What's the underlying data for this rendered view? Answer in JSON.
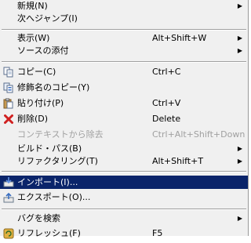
{
  "menu": {
    "items": [
      {
        "label": "新規(N)",
        "shortcut": "",
        "submenu": true
      },
      {
        "label": "次へジャンプ(I)",
        "shortcut": "",
        "submenu": false
      },
      {
        "label": "表示(W)",
        "shortcut": "Alt+Shift+W",
        "submenu": true
      },
      {
        "label": "ソースの添付",
        "shortcut": "",
        "submenu": true
      },
      {
        "label": "コピー(C)",
        "shortcut": "Ctrl+C",
        "icon": "copy-icon"
      },
      {
        "label": "修飾名のコピー(Y)",
        "shortcut": "",
        "icon": "qualified-copy-icon"
      },
      {
        "label": "貼り付け(P)",
        "shortcut": "Ctrl+V",
        "icon": "paste-icon"
      },
      {
        "label": "削除(D)",
        "shortcut": "Delete",
        "icon": "delete-icon"
      },
      {
        "label": "コンテキストから除去",
        "shortcut": "Ctrl+Alt+Shift+Down",
        "disabled": true
      },
      {
        "label": "ビルド・パス(B)",
        "shortcut": "",
        "submenu": true
      },
      {
        "label": "リファクタリング(T)",
        "shortcut": "Alt+Shift+T",
        "submenu": true
      },
      {
        "label": "インポート(I)...",
        "shortcut": "",
        "icon": "import-icon",
        "highlighted": true
      },
      {
        "label": "エクスポート(O)...",
        "shortcut": "",
        "icon": "export-icon"
      },
      {
        "label": "バグを検索",
        "shortcut": "",
        "submenu": true
      },
      {
        "label": "リフレッシュ(F)",
        "shortcut": "F5",
        "icon": "refresh-icon"
      }
    ]
  },
  "colors": {
    "highlight": "#0a246a",
    "menu_background": "#f0f0f0",
    "disabled_text": "#a0a0a0"
  }
}
